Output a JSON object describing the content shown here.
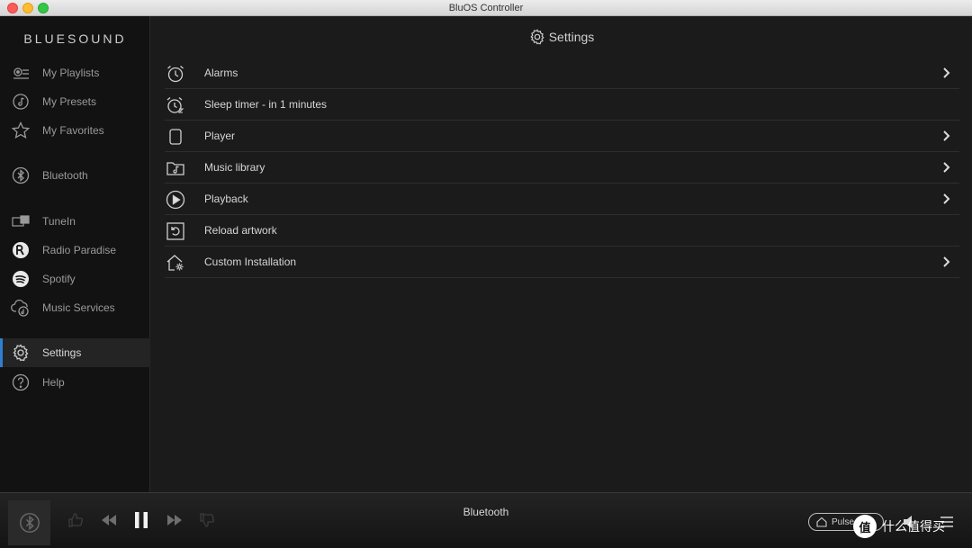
{
  "window": {
    "title": "BluOS Controller"
  },
  "sidebar": {
    "brand": "BLUESOUND",
    "items": [
      {
        "label": "My Playlists",
        "icon": "playlist-icon"
      },
      {
        "label": "My Presets",
        "icon": "preset-icon"
      },
      {
        "label": "My Favorites",
        "icon": "star-icon"
      },
      {
        "label": "Bluetooth",
        "icon": "bluetooth-icon"
      },
      {
        "label": "TuneIn",
        "icon": "tunein-icon"
      },
      {
        "label": "Radio Paradise",
        "icon": "radio-paradise-icon"
      },
      {
        "label": "Spotify",
        "icon": "spotify-icon"
      },
      {
        "label": "Music Services",
        "icon": "cloud-music-icon"
      },
      {
        "label": "Settings",
        "icon": "gear-icon",
        "active": true
      },
      {
        "label": "Help",
        "icon": "help-icon"
      }
    ]
  },
  "main": {
    "title": "Settings",
    "rows": [
      {
        "label": "Alarms",
        "icon": "alarm-clock-icon",
        "chevron": true
      },
      {
        "label": "Sleep timer - in 1 minutes",
        "icon": "sleep-timer-icon",
        "chevron": false
      },
      {
        "label": "Player",
        "icon": "player-device-icon",
        "chevron": true
      },
      {
        "label": "Music library",
        "icon": "music-folder-icon",
        "chevron": true
      },
      {
        "label": "Playback",
        "icon": "play-circle-icon",
        "chevron": true
      },
      {
        "label": "Reload artwork",
        "icon": "reload-icon",
        "chevron": false
      },
      {
        "label": "Custom Installation",
        "icon": "home-gear-icon",
        "chevron": true
      }
    ]
  },
  "player": {
    "source": "Bluetooth",
    "zone_label": "Pulse",
    "state": "playing"
  },
  "watermark": {
    "text": "什么值得买",
    "badge": "值"
  },
  "colors": {
    "accent": "#2f7fd0",
    "background": "#1b1b1b",
    "sidebar": "#121212"
  }
}
